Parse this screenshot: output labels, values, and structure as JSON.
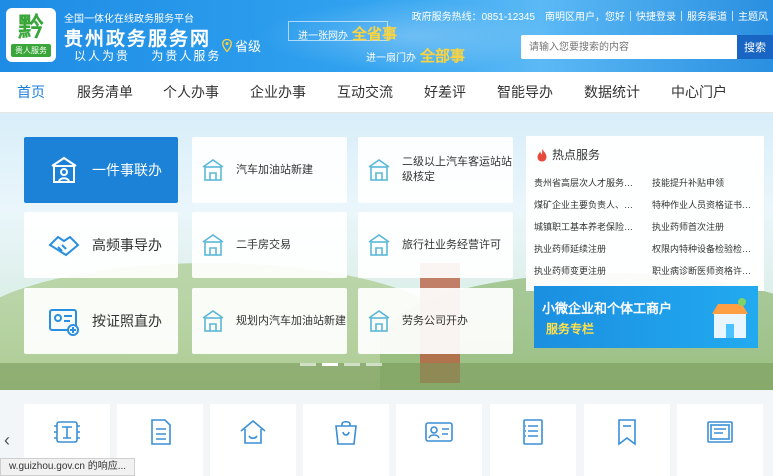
{
  "header": {
    "logo_glyph": "黔",
    "logo_sub": "贵人服务",
    "site_tag": "全国一体化在线政务服务平台",
    "site_title": "贵州政务服务网",
    "slogan_left": "以人为贵",
    "slogan_right": "为贵人服务",
    "region": "省级",
    "promo_line1_prefix": "进一张网办",
    "promo_line1_emph": "全省事",
    "promo_line2_prefix": "进一扇门办",
    "promo_line2_emph": "全部事"
  },
  "topbar": {
    "hotline": "政府服务热线：0851-12345",
    "user": "南明区用户，您好",
    "login": "快捷登录",
    "channel": "服务渠道",
    "theme": "主题风"
  },
  "search": {
    "placeholder": "请输入您要搜索的内容",
    "button": "搜索"
  },
  "nav": [
    "首页",
    "服务清单",
    "个人办事",
    "企业办事",
    "互动交流",
    "好差评",
    "智能导办",
    "数据统计",
    "中心门户"
  ],
  "quick": {
    "one_thing": "一件事联办",
    "high_freq": "高频事导办",
    "license": "按证照直办"
  },
  "services": [
    "汽车加油站新建",
    "二级以上汽车客运站站级核定",
    "二手房交易",
    "旅行社业务经营许可",
    "规划内汽车加油站新建",
    "劳务公司开办"
  ],
  "hot": {
    "title": "热点服务",
    "items": [
      "贵州省高层次人才服务…",
      "技能提升补贴申领",
      "煤矿企业主要负责人、…",
      "特种作业人员资格证书…",
      "城镇职工基本养老保险…",
      "执业药师首次注册",
      "执业药师延续注册",
      "权限内特种设备检验检…",
      "执业药师变更注册",
      "职业病诊断医师资格许…"
    ]
  },
  "promo": {
    "line1": "小微企业和个体工商户",
    "line2": "服务专栏"
  },
  "bottom_icons": [
    "tax-icon",
    "list-icon",
    "home-icon",
    "bag-icon",
    "id-card-icon",
    "document-icon",
    "bookmark-icon",
    "certificate-icon"
  ],
  "status_text": "w.guizhou.gov.cn 的响应..."
}
